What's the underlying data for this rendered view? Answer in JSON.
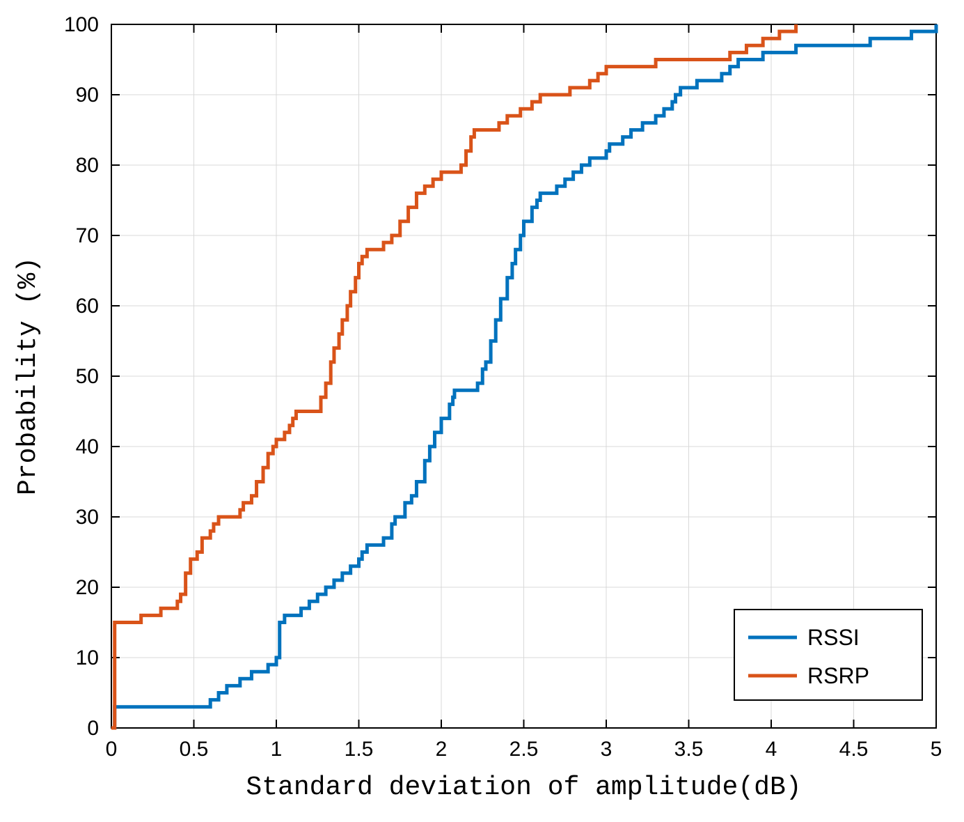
{
  "chart_data": {
    "type": "line",
    "subtype": "cdf-step",
    "xlabel": "Standard deviation of amplitude(dB)",
    "ylabel": "Probability (%)",
    "xlim": [
      0,
      5
    ],
    "ylim": [
      0,
      100
    ],
    "xticks": [
      0,
      0.5,
      1,
      1.5,
      2,
      2.5,
      3,
      3.5,
      4,
      4.5,
      5
    ],
    "yticks": [
      0,
      10,
      20,
      30,
      40,
      50,
      60,
      70,
      80,
      90,
      100
    ],
    "grid": true,
    "legend_position": "bottom-right",
    "colors": {
      "RSSI": "#0072BD",
      "RSRP": "#D95319"
    },
    "series": [
      {
        "name": "RSSI",
        "color": "#0072BD",
        "points": [
          [
            0.0,
            0
          ],
          [
            0.02,
            3
          ],
          [
            0.58,
            3
          ],
          [
            0.6,
            4
          ],
          [
            0.65,
            5
          ],
          [
            0.7,
            6
          ],
          [
            0.78,
            7
          ],
          [
            0.85,
            8
          ],
          [
            0.95,
            9
          ],
          [
            1.0,
            10
          ],
          [
            1.02,
            15
          ],
          [
            1.05,
            16
          ],
          [
            1.12,
            16
          ],
          [
            1.15,
            17
          ],
          [
            1.2,
            18
          ],
          [
            1.25,
            19
          ],
          [
            1.3,
            20
          ],
          [
            1.35,
            21
          ],
          [
            1.4,
            22
          ],
          [
            1.45,
            23
          ],
          [
            1.5,
            24
          ],
          [
            1.52,
            25
          ],
          [
            1.55,
            26
          ],
          [
            1.6,
            26
          ],
          [
            1.65,
            27
          ],
          [
            1.7,
            29
          ],
          [
            1.72,
            30
          ],
          [
            1.78,
            32
          ],
          [
            1.82,
            33
          ],
          [
            1.85,
            35
          ],
          [
            1.9,
            38
          ],
          [
            1.93,
            40
          ],
          [
            1.96,
            42
          ],
          [
            2.0,
            44
          ],
          [
            2.05,
            46
          ],
          [
            2.07,
            47
          ],
          [
            2.08,
            48
          ],
          [
            2.2,
            48
          ],
          [
            2.22,
            49
          ],
          [
            2.25,
            51
          ],
          [
            2.27,
            52
          ],
          [
            2.3,
            55
          ],
          [
            2.33,
            58
          ],
          [
            2.36,
            61
          ],
          [
            2.4,
            64
          ],
          [
            2.43,
            66
          ],
          [
            2.45,
            68
          ],
          [
            2.48,
            70
          ],
          [
            2.5,
            72
          ],
          [
            2.55,
            74
          ],
          [
            2.58,
            75
          ],
          [
            2.6,
            76
          ],
          [
            2.7,
            77
          ],
          [
            2.75,
            78
          ],
          [
            2.8,
            79
          ],
          [
            2.85,
            80
          ],
          [
            2.9,
            81
          ],
          [
            3.0,
            82
          ],
          [
            3.02,
            83
          ],
          [
            3.1,
            84
          ],
          [
            3.15,
            85
          ],
          [
            3.22,
            86
          ],
          [
            3.3,
            87
          ],
          [
            3.35,
            88
          ],
          [
            3.4,
            89
          ],
          [
            3.42,
            90
          ],
          [
            3.45,
            91
          ],
          [
            3.55,
            92
          ],
          [
            3.7,
            93
          ],
          [
            3.75,
            94
          ],
          [
            3.8,
            95
          ],
          [
            3.95,
            96
          ],
          [
            4.15,
            97
          ],
          [
            4.55,
            97
          ],
          [
            4.6,
            98
          ],
          [
            4.85,
            99
          ],
          [
            4.95,
            99
          ],
          [
            5.0,
            100
          ]
        ]
      },
      {
        "name": "RSRP",
        "color": "#D95319",
        "points": [
          [
            0.0,
            0
          ],
          [
            0.02,
            15
          ],
          [
            0.15,
            15
          ],
          [
            0.18,
            16
          ],
          [
            0.28,
            16
          ],
          [
            0.3,
            17
          ],
          [
            0.4,
            18
          ],
          [
            0.42,
            19
          ],
          [
            0.45,
            22
          ],
          [
            0.48,
            24
          ],
          [
            0.52,
            25
          ],
          [
            0.55,
            27
          ],
          [
            0.6,
            28
          ],
          [
            0.62,
            29
          ],
          [
            0.65,
            30
          ],
          [
            0.75,
            30
          ],
          [
            0.78,
            31
          ],
          [
            0.8,
            32
          ],
          [
            0.85,
            33
          ],
          [
            0.88,
            35
          ],
          [
            0.92,
            37
          ],
          [
            0.95,
            39
          ],
          [
            0.98,
            40
          ],
          [
            1.0,
            41
          ],
          [
            1.05,
            42
          ],
          [
            1.08,
            43
          ],
          [
            1.1,
            44
          ],
          [
            1.12,
            45
          ],
          [
            1.25,
            45
          ],
          [
            1.27,
            47
          ],
          [
            1.3,
            49
          ],
          [
            1.33,
            52
          ],
          [
            1.35,
            54
          ],
          [
            1.38,
            56
          ],
          [
            1.4,
            58
          ],
          [
            1.43,
            60
          ],
          [
            1.45,
            62
          ],
          [
            1.48,
            64
          ],
          [
            1.5,
            66
          ],
          [
            1.52,
            67
          ],
          [
            1.55,
            68
          ],
          [
            1.65,
            69
          ],
          [
            1.7,
            70
          ],
          [
            1.75,
            72
          ],
          [
            1.8,
            74
          ],
          [
            1.85,
            76
          ],
          [
            1.9,
            77
          ],
          [
            1.95,
            78
          ],
          [
            2.0,
            79
          ],
          [
            2.1,
            79
          ],
          [
            2.12,
            80
          ],
          [
            2.15,
            82
          ],
          [
            2.18,
            84
          ],
          [
            2.2,
            85
          ],
          [
            2.3,
            85
          ],
          [
            2.35,
            86
          ],
          [
            2.4,
            87
          ],
          [
            2.48,
            88
          ],
          [
            2.55,
            89
          ],
          [
            2.6,
            90
          ],
          [
            2.75,
            90
          ],
          [
            2.78,
            91
          ],
          [
            2.9,
            92
          ],
          [
            2.95,
            93
          ],
          [
            3.0,
            94
          ],
          [
            3.25,
            94
          ],
          [
            3.3,
            95
          ],
          [
            3.7,
            95
          ],
          [
            3.75,
            96
          ],
          [
            3.85,
            97
          ],
          [
            3.95,
            98
          ],
          [
            4.05,
            99
          ],
          [
            4.15,
            100
          ]
        ]
      }
    ]
  },
  "legend": {
    "items": [
      {
        "label": "RSSI",
        "color": "#0072BD"
      },
      {
        "label": "RSRP",
        "color": "#D95319"
      }
    ]
  }
}
